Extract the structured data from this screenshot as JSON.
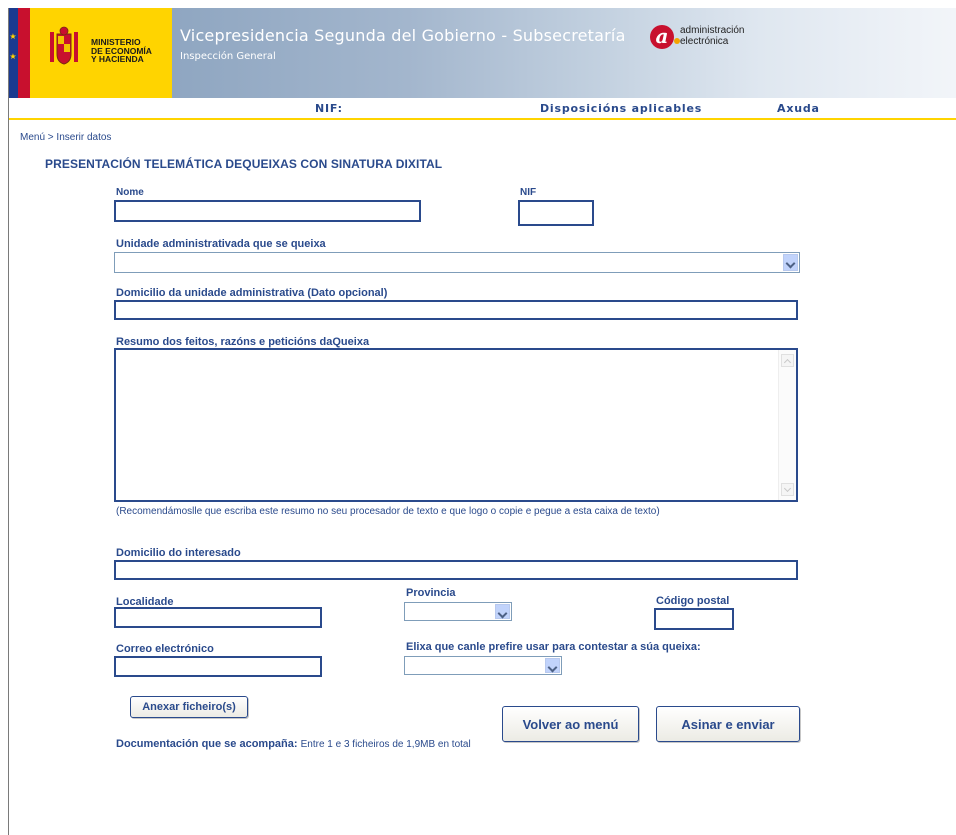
{
  "header": {
    "ministry_line1": "MINISTERIO",
    "ministry_line2": "DE ECONOMÍA",
    "ministry_line3": "Y HACIENDA",
    "title": "Vicepresidencia Segunda del Gobierno - Subsecretaría",
    "subtitle": "Inspección General",
    "ae_line1": "administración",
    "ae_line2": "electrónica",
    "ae_symbol": "a"
  },
  "nav": {
    "nif": "NIF:",
    "disposicions": "Disposicións aplicables",
    "axuda": "Axuda"
  },
  "breadcrumb": "Menú > Inserir datos",
  "page_title": "PRESENTACIÓN TELEMÁTICA DEQUEIXAS CON SINATURA DIXITAL",
  "form": {
    "nome_label": "Nome",
    "nome_value": "",
    "nif_label": "NIF",
    "nif_value": "",
    "unidade_label": "Unidade administrativada que se queixa",
    "unidade_value": "",
    "domicilio_unidade_label": "Domicilio da unidade administrativa (Dato opcional)",
    "domicilio_unidade_value": "",
    "resumo_label": "Resumo dos feitos, razóns e peticións daQueixa",
    "resumo_value": "",
    "resumo_hint": "(Recomendámoslle que escriba este resumo no seu procesador de texto e que logo o copie e pegue a esta caixa de texto)",
    "domicilio_interesado_label": "Domicilio do interesado",
    "domicilio_interesado_value": "",
    "localidade_label": "Localidade",
    "localidade_value": "",
    "provincia_label": "Provincia",
    "provincia_value": "",
    "codigo_postal_label": "Código postal",
    "codigo_postal_value": "",
    "correo_label": "Correo electrónico",
    "correo_value": "",
    "canle_label": "Elixa que canle prefire usar para contestar a súa queixa:",
    "canle_value": ""
  },
  "buttons": {
    "anexar": "Anexar ficheiro(s)",
    "volver": "Volver ao menú",
    "asinar": "Asinar e enviar"
  },
  "documentacion": {
    "label": "Documentación que se acompaña:",
    "note": "Entre 1 e 3 ficheiros de 1,9MB en total"
  },
  "colors": {
    "brand_blue": "#2a4a8c",
    "flag_yellow": "#ffd400",
    "flag_red": "#c8102e"
  }
}
